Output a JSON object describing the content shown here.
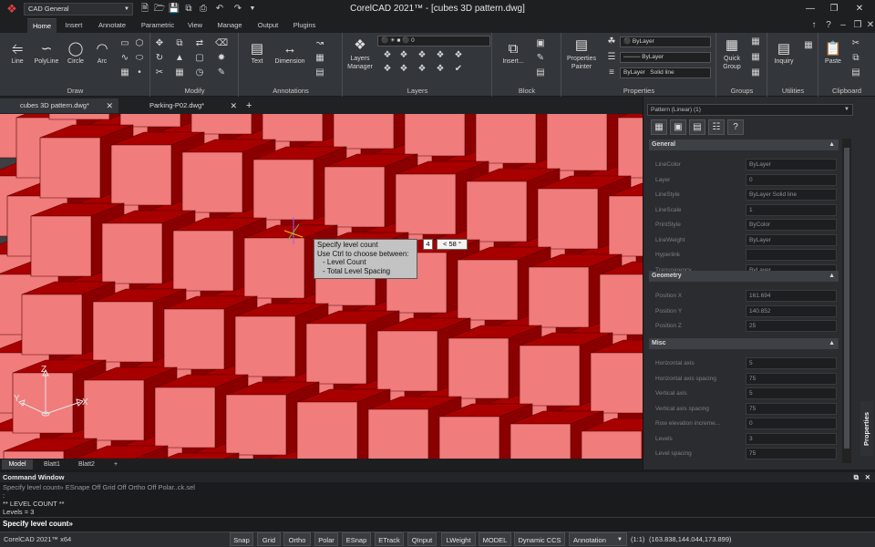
{
  "app": {
    "workspace": "CAD General",
    "title": "CorelCAD 2021™ - [cubes 3D pattern.dwg]"
  },
  "ribbon_tabs": [
    "Home",
    "Insert",
    "Annotate",
    "Parametric",
    "View",
    "Manage",
    "Output",
    "Plugins"
  ],
  "ribbon": {
    "draw": {
      "label": "Draw",
      "line": "Line",
      "polyline": "PolyLine",
      "circle": "Circle",
      "arc": "Arc"
    },
    "modify": {
      "label": "Modify"
    },
    "annotations": {
      "label": "Annotations",
      "text": "Text",
      "dimension": "Dimension"
    },
    "layers": {
      "label": "Layers",
      "manager": "Layers Manager",
      "current": "0"
    },
    "block": {
      "label": "Block",
      "insert": "Insert..."
    },
    "properties": {
      "label": "Properties",
      "painter": "Properties Painter",
      "color": "ByLayer",
      "linestyle": "ByLayer",
      "lineweight": "ByLayer",
      "lineweight_style": "Solid line"
    },
    "groups": {
      "label": "Groups",
      "quick": "Quick Group"
    },
    "utilities": {
      "label": "Utilities",
      "inquiry": "Inquiry"
    },
    "clipboard": {
      "label": "Clipboard",
      "paste": "Paste"
    }
  },
  "doc_tabs": [
    "cubes 3D pattern.dwg*",
    "Parking-P02.dwg*"
  ],
  "tooltip": {
    "line1": "Specify level count",
    "line2": "Use Ctrl to choose between:",
    "line3": "- Level Count",
    "line4": "- Total Level Spacing",
    "input_count": "4",
    "input_angle": "< 58 °"
  },
  "ucs": {
    "x": "X",
    "y": "Y",
    "z": "Z"
  },
  "layout_tabs": [
    "Model",
    "Blatt1",
    "Blatt2",
    "+"
  ],
  "properties": {
    "selector": "Pattern (Linear) (1)",
    "tab_label": "Properties",
    "sections": {
      "general": {
        "title": "General",
        "rows": [
          {
            "label": "LineColor",
            "value": "ByLayer"
          },
          {
            "label": "Layer",
            "value": "0"
          },
          {
            "label": "LineStyle",
            "value": "ByLayer        Solid line"
          },
          {
            "label": "LineScale",
            "value": "1"
          },
          {
            "label": "PrintStyle",
            "value": "ByColor"
          },
          {
            "label": "LineWeight",
            "value": "ByLayer"
          },
          {
            "label": "Hyperlink",
            "value": ""
          },
          {
            "label": "Transparency",
            "value": "ByLayer"
          }
        ]
      },
      "geometry": {
        "title": "Geometry",
        "rows": [
          {
            "label": "Position X",
            "value": "161.694"
          },
          {
            "label": "Position Y",
            "value": "140.852"
          },
          {
            "label": "Position Z",
            "value": "25"
          }
        ]
      },
      "misc": {
        "title": "Misc",
        "rows": [
          {
            "label": "Horizontal axis",
            "value": "5"
          },
          {
            "label": "Horizontal axis spacing",
            "value": "75"
          },
          {
            "label": "Vertical axis",
            "value": "5"
          },
          {
            "label": "Vertical axis spacing",
            "value": "75"
          },
          {
            "label": "Row elevation increme...",
            "value": "0"
          },
          {
            "label": "Levels",
            "value": "3"
          },
          {
            "label": "Level spacing",
            "value": "75"
          }
        ]
      }
    }
  },
  "command": {
    "title": "Command Window",
    "lines": [
      "Specify level count»    ESnape Off    Grid Off    Ortho Off    Polar..ck.sel",
      ":",
      "** LEVEL COUNT **",
      "Levels = 3"
    ],
    "prompt": "Specify level count»"
  },
  "status": {
    "app": "CorelCAD 2021™ x64",
    "buttons": [
      "Snap",
      "Grid",
      "Ortho",
      "Polar",
      "ESnap",
      "ETrack",
      "QInput",
      "LWeight",
      "MODEL",
      "Dynamic CCS",
      "Annotation"
    ],
    "scale": "(1:1)",
    "coords": "(163.838,144.044,173.899)"
  },
  "colors": {
    "cube_top": "#a80000",
    "cube_side": "#8a0000",
    "cube_front": "#f07c7c",
    "accent": "#e04040"
  }
}
